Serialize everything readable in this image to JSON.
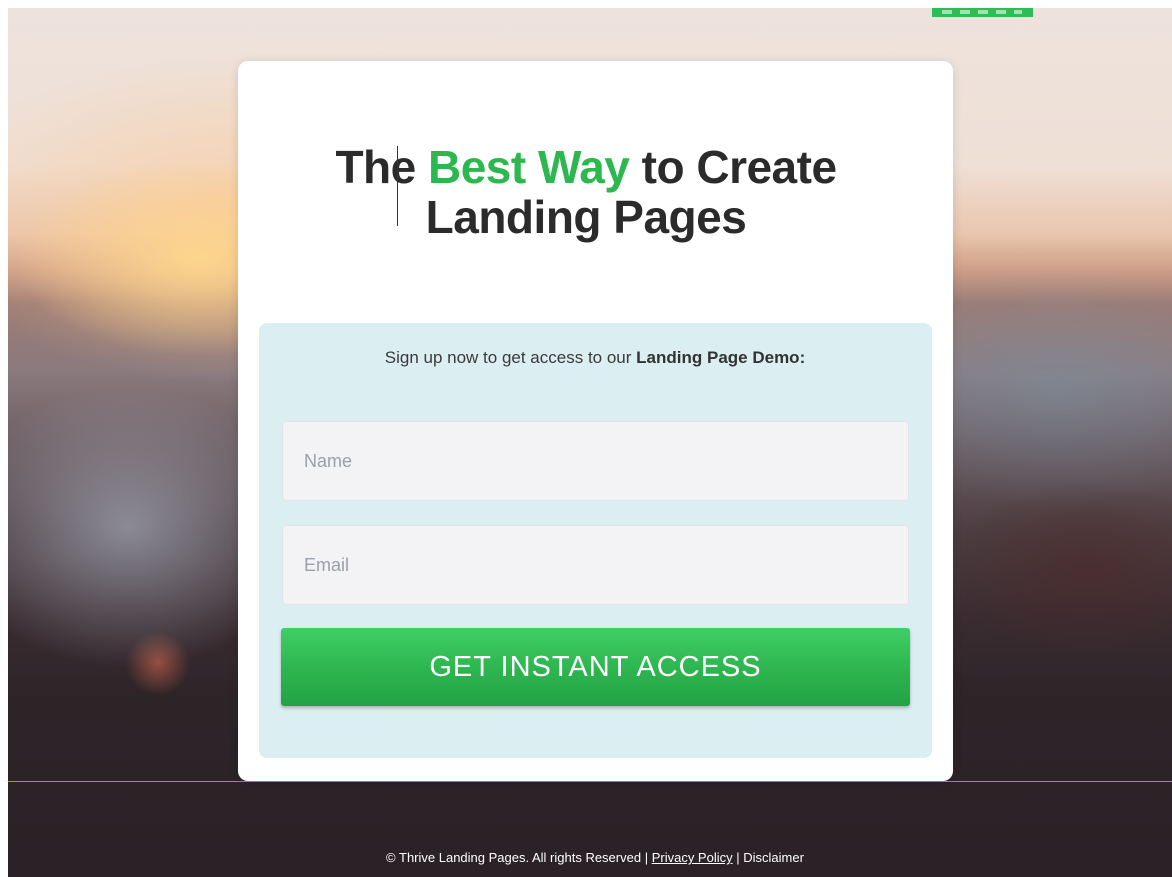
{
  "headline": {
    "prefix": "The",
    "accent": "Best Way",
    "suffix": "to Create",
    "line2": "Landing Pages"
  },
  "form": {
    "intro_text": "Sign up now to get access to our",
    "intro_bold": "Landing Page Demo:",
    "name_placeholder": "Name",
    "email_placeholder": "Email",
    "submit_label": "GET INSTANT ACCESS"
  },
  "footer": {
    "copyright": "© Thrive Landing Pages. All rights Reserved |",
    "privacy_label": "Privacy Policy",
    "separator": "|",
    "disclaimer_label": "Disclaimer"
  },
  "colors": {
    "accent": "#2db84f",
    "panel": "#dbeef2",
    "button": "#33be55"
  }
}
